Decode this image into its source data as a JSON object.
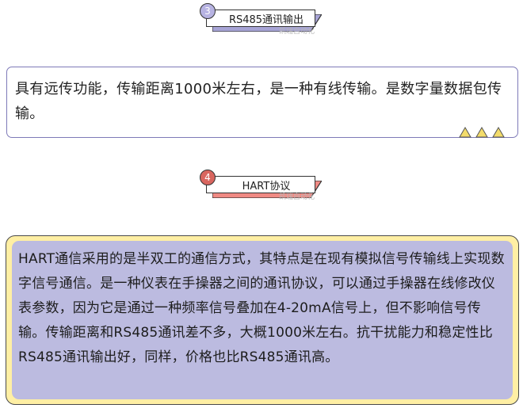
{
  "section3": {
    "number": "3",
    "title": "RS485通讯输出",
    "watermark": "凯瑞自动化",
    "accent": "#a7a4d6",
    "number_bg": "#b7b3e2"
  },
  "box1": {
    "text": "具有远传功能，传输距离1000米左右，是一种有线传输。是数字量数据包传输。",
    "border_color": "#7e7ab8",
    "triangle_color": "#f3dc6b"
  },
  "section4": {
    "number": "4",
    "title": "HART协议",
    "watermark": "凯瑞自动化",
    "accent": "#f08a84",
    "number_bg": "#d9665f"
  },
  "box2": {
    "text": "HART通信采用的是半双工的通信方式，其特点是在现有模拟信号传输线上实现数字信号通信。是一种仪表在手操器之间的通讯协议，可以通过手操器在线修改仪表参数，因为它是通过一种频率信号叠加在4-20mA信号上，但不影响信号传输。传输距离和RS485通讯差不多，大概1000米左右。抗干扰能力和稳定性比RS485通讯输出好，同样，价格也比RS485通讯高。",
    "outer_color": "#ffefa4",
    "inner_color": "#bcbbe0"
  }
}
